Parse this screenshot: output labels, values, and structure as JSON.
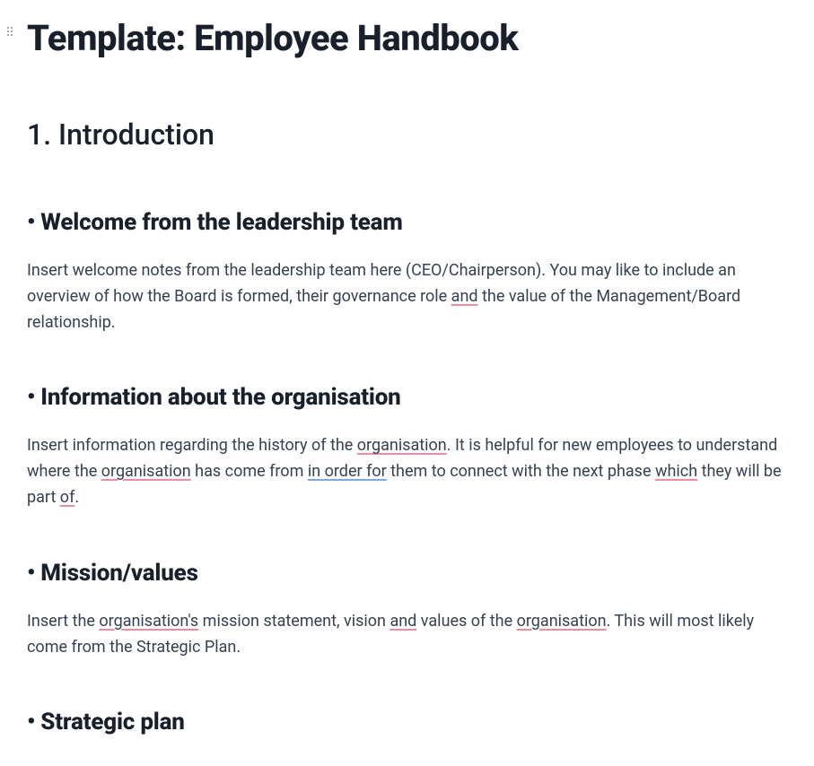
{
  "title": "Template: Employee Handbook",
  "section1": {
    "heading": "1. Introduction",
    "items": [
      {
        "heading": "Welcome from the leadership team",
        "segments": [
          {
            "t": "Insert welcome notes from the leadership team here (CEO/Chairperson). You may like to include an overview of how the Board is formed, their governance role "
          },
          {
            "t": "and",
            "c": "ul-pink"
          },
          {
            "t": " the value of the Management/Board relationship."
          }
        ]
      },
      {
        "heading": "Information about the organisation",
        "segments": [
          {
            "t": "Insert information regarding the history of the "
          },
          {
            "t": "organisation",
            "c": "ul-pink"
          },
          {
            "t": ". It is helpful for new employees to understand where the "
          },
          {
            "t": "organisation",
            "c": "ul-pink"
          },
          {
            "t": " has come from "
          },
          {
            "t": "in order for",
            "c": "ul-blue"
          },
          {
            "t": " them to connect with the next phase "
          },
          {
            "t": "which",
            "c": "ul-pink"
          },
          {
            "t": " they will be part "
          },
          {
            "t": "of",
            "c": "ul-pink"
          },
          {
            "t": "."
          }
        ]
      },
      {
        "heading": "Mission/values",
        "segments": [
          {
            "t": "Insert the "
          },
          {
            "t": "organisation's",
            "c": "ul-pink"
          },
          {
            "t": " mission statement, vision "
          },
          {
            "t": "and",
            "c": "ul-pink"
          },
          {
            "t": " values of the "
          },
          {
            "t": "organisation",
            "c": "ul-pink"
          },
          {
            "t": ". This will most likely come from the Strategic Plan."
          }
        ]
      },
      {
        "heading": "Strategic plan",
        "segments": []
      }
    ]
  }
}
